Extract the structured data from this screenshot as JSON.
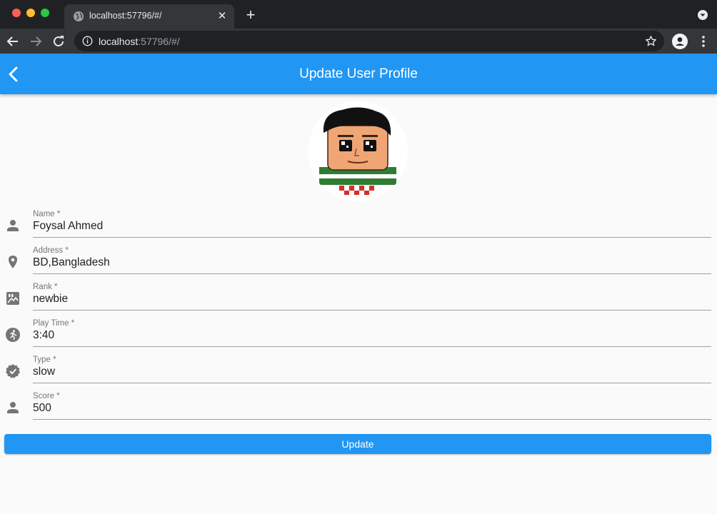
{
  "browser": {
    "tab_title": "localhost:57796/#/",
    "tab_close": "✕",
    "new_tab": "+",
    "url_host": "localhost",
    "url_rest": ":57796/#/"
  },
  "appbar": {
    "title": "Update User Profile"
  },
  "form": {
    "fields": [
      {
        "label": "Name *",
        "value": "Foysal Ahmed",
        "icon": "person-icon"
      },
      {
        "label": "Address *",
        "value": "BD,Bangladesh",
        "icon": "location-pin-icon"
      },
      {
        "label": "Rank *",
        "value": "newbie",
        "icon": "rank-image-icon"
      },
      {
        "label": "Play Time *",
        "value": "3:40",
        "icon": "running-icon"
      },
      {
        "label": "Type *",
        "value": "slow",
        "icon": "verified-badge-icon"
      },
      {
        "label": "Score *",
        "value": "500",
        "icon": "person-icon"
      }
    ],
    "submit_label": "Update"
  },
  "colors": {
    "primary": "#2196f3",
    "chrome_dark": "#202124",
    "chrome_mid": "#35363a"
  }
}
